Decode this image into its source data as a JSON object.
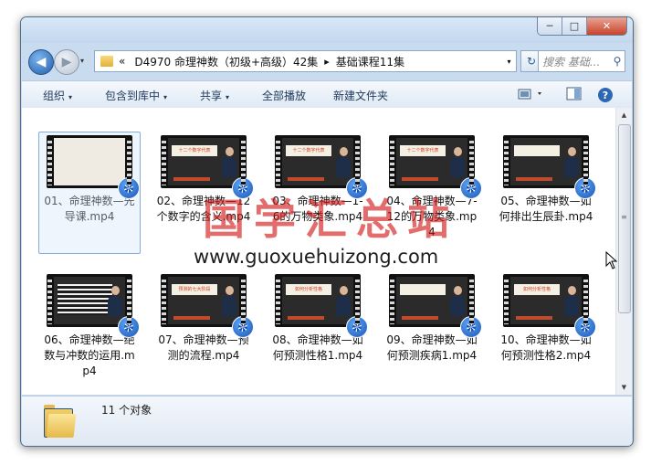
{
  "window": {
    "caption_buttons": {
      "minimize": "─",
      "maximize": "□",
      "close": "✕"
    }
  },
  "nav": {
    "back_icon": "◀",
    "forward_icon": "▶",
    "dropdown": "▾"
  },
  "address": {
    "prefix": "«",
    "crumbs": [
      "D4970 命理神数（初级+高级）42集",
      "基础课程11集"
    ],
    "separator": "▸",
    "dropdown": "▾",
    "refresh": "↻"
  },
  "search": {
    "placeholder": "搜索 基础...",
    "icon": "search-icon"
  },
  "toolbar": {
    "organize": "组织",
    "include_in_library": "包含到库中",
    "share": "共享",
    "play_all": "全部播放",
    "new_folder": "新建文件夹",
    "dropdown": "▾",
    "help": "?"
  },
  "files": [
    {
      "name": "01、命理神数—先导课.mp4",
      "thumb": "paper",
      "selected": true
    },
    {
      "name": "02、命理神数—12个数字的含义.mp4",
      "thumb": "slide"
    },
    {
      "name": "03、命理神数—1-6的万物类象.mp4",
      "thumb": "slide"
    },
    {
      "name": "04、命理神数—7-12的万物类象.mp4",
      "thumb": "slide"
    },
    {
      "name": "05、命理神数—如何排出生辰卦.mp4",
      "thumb": "slide"
    },
    {
      "name": "06、命理神数—绝数与冲数的运用.mp4",
      "thumb": "text"
    },
    {
      "name": "07、命理神数—预测的流程.mp4",
      "thumb": "slide"
    },
    {
      "name": "08、命理神数—如何预测性格1.mp4",
      "thumb": "slide"
    },
    {
      "name": "09、命理神数—如何预测疾病1.mp4",
      "thumb": "slide"
    },
    {
      "name": "10、命理神数—如何预测性格2.mp4",
      "thumb": "slide"
    }
  ],
  "thumb_titles": [
    "",
    "十二个数字代表",
    "十二个数字代表",
    "十二个数字代表",
    "",
    "",
    "预测的七大阶段",
    "如何分析性格",
    "",
    "如何分析性格"
  ],
  "scrollbar": {
    "up": "▲",
    "down": "▼",
    "grip": "≡"
  },
  "status": {
    "count_text": "11 个对象"
  },
  "watermark": {
    "chinese": "国学汇总站",
    "url": "www.guoxuehuizong.com"
  }
}
